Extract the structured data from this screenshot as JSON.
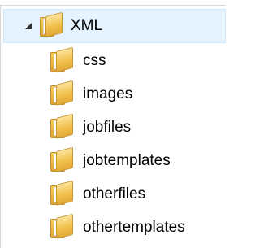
{
  "tree": {
    "root": {
      "label": "XML",
      "expander_icon": "triangle-expanded-icon",
      "icon": "folder-icon",
      "selected": true
    },
    "children": [
      {
        "label": "css",
        "icon": "folder-icon"
      },
      {
        "label": "images",
        "icon": "folder-icon"
      },
      {
        "label": "jobfiles",
        "icon": "folder-icon"
      },
      {
        "label": "jobtemplates",
        "icon": "folder-icon"
      },
      {
        "label": "otherfiles",
        "icon": "folder-icon"
      },
      {
        "label": "othertemplates",
        "icon": "folder-icon"
      }
    ]
  },
  "colors": {
    "selection_background": "#e5f3ff",
    "selection_border": "#cde8ff",
    "folder_yellow": "#f2c14e",
    "text": "#000000"
  }
}
